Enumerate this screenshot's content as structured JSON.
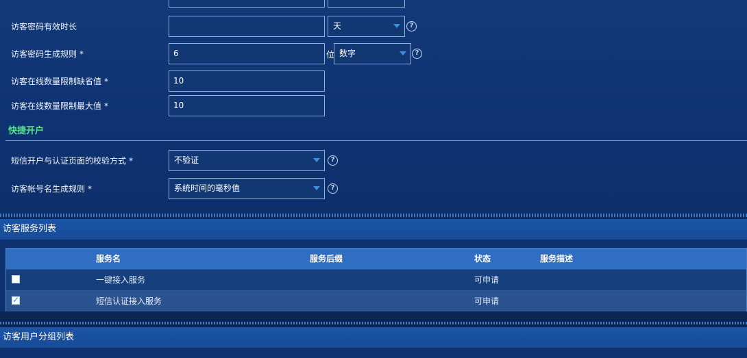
{
  "form": {
    "pwd_validity_label": "访客密码有效时长",
    "pwd_validity_value": "",
    "pwd_validity_unit": "天",
    "pwd_rule_label": "访客密码生成规则",
    "pwd_rule_length": "6",
    "pwd_rule_length_unit": "位",
    "pwd_rule_type": "数字",
    "online_default_label": "访客在线数量限制缺省值",
    "online_default_value": "10",
    "online_max_label": "访客在线数量限制最大值",
    "online_max_value": "10",
    "required_mark": "*",
    "help_symbol": "?"
  },
  "quick_open": {
    "title": "快捷开户",
    "verify_label": "短信开户与认证页面的校验方式",
    "verify_value": "不验证",
    "account_rule_label": "访客帐号名生成规则",
    "account_rule_value": "系统时间的毫秒值"
  },
  "service_list": {
    "title": "访客服务列表",
    "columns": [
      "服务名",
      "服务后缀",
      "状态",
      "服务描述"
    ],
    "rows": [
      {
        "name": "一键接入服务",
        "suffix": "",
        "status": "可申请",
        "desc": "",
        "checked": false
      },
      {
        "name": "短信认证接入服务",
        "suffix": "",
        "status": "可申请",
        "desc": "",
        "checked": true
      }
    ]
  },
  "group_list": {
    "title": "访客用户分组列表"
  }
}
